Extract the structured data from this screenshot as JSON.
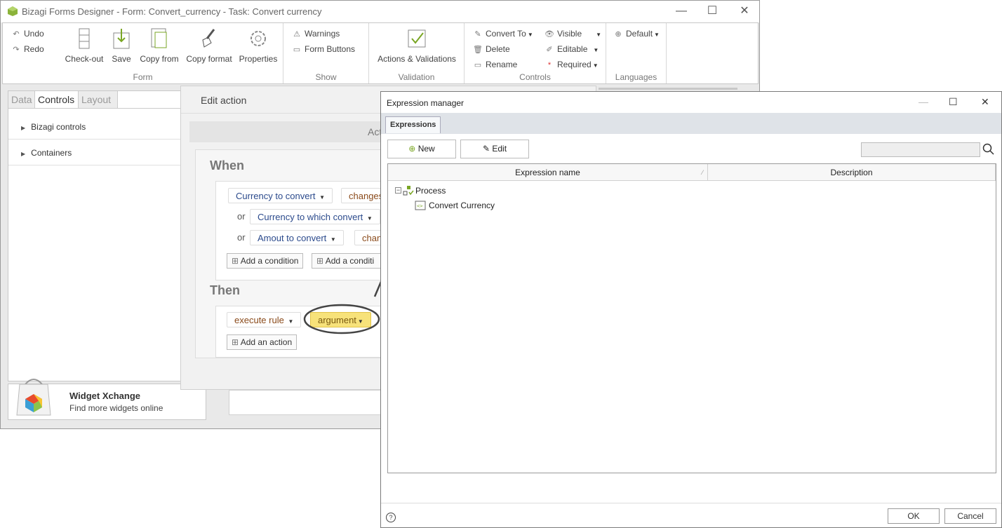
{
  "designer": {
    "title": "Bizagi Forms Designer  - Form: Convert_currency - Task:  Convert currency",
    "window_controls": {
      "minimize": "—",
      "maximize": "☐",
      "close": "✕"
    },
    "ribbon": {
      "form_group": {
        "label": "Form",
        "undo": "Undo",
        "redo": "Redo",
        "checkout": "Check-out",
        "save": "Save",
        "copy_from": "Copy from",
        "copy_format": "Copy format",
        "properties": "Properties"
      },
      "show_group": {
        "label": "Show",
        "warnings": "Warnings",
        "form_buttons": "Form Buttons"
      },
      "validation_group": {
        "label": "Validation",
        "actions_validations": "Actions & Validations"
      },
      "controls_group": {
        "label": "Controls",
        "convert_to": "Convert To",
        "delete": "Delete",
        "rename": "Rename",
        "visible": "Visible",
        "editable": "Editable",
        "required": "Required"
      },
      "languages_group": {
        "label": "Languages",
        "default": "Default"
      }
    },
    "left_panel": {
      "tabs": [
        "Data",
        "Controls",
        "Layout"
      ],
      "items": [
        "Bizagi controls",
        "Containers"
      ]
    },
    "widget": {
      "title": "Widget Xchange",
      "subtitle": "Find more widgets online"
    }
  },
  "edit_action": {
    "title": "Edit action",
    "header_partial": "Act",
    "when": {
      "title": "When",
      "conditions": [
        {
          "prefix": "",
          "field": "Currency to convert",
          "op": "changes"
        },
        {
          "prefix": "or",
          "field": "Currency to which convert",
          "op": ""
        },
        {
          "prefix": "or",
          "field": "Amout to convert",
          "op": "chan"
        }
      ],
      "add_condition": "Add a condition",
      "add_condition_group": "Add a conditi"
    },
    "then": {
      "title": "Then",
      "command": "execute rule",
      "argument": "argument",
      "add_action": "Add an action"
    }
  },
  "expression_manager": {
    "title": "Expression manager",
    "tab": "Expressions",
    "new_label": "New",
    "edit_label": "Edit",
    "columns": [
      "Expression name",
      "Description"
    ],
    "tree": {
      "root": "Process",
      "child": "Convert Currency"
    },
    "ok": "OK",
    "cancel": "Cancel",
    "help": "?"
  },
  "colors": {
    "highlight": "#f7e27a",
    "accent": "#7aa624"
  }
}
